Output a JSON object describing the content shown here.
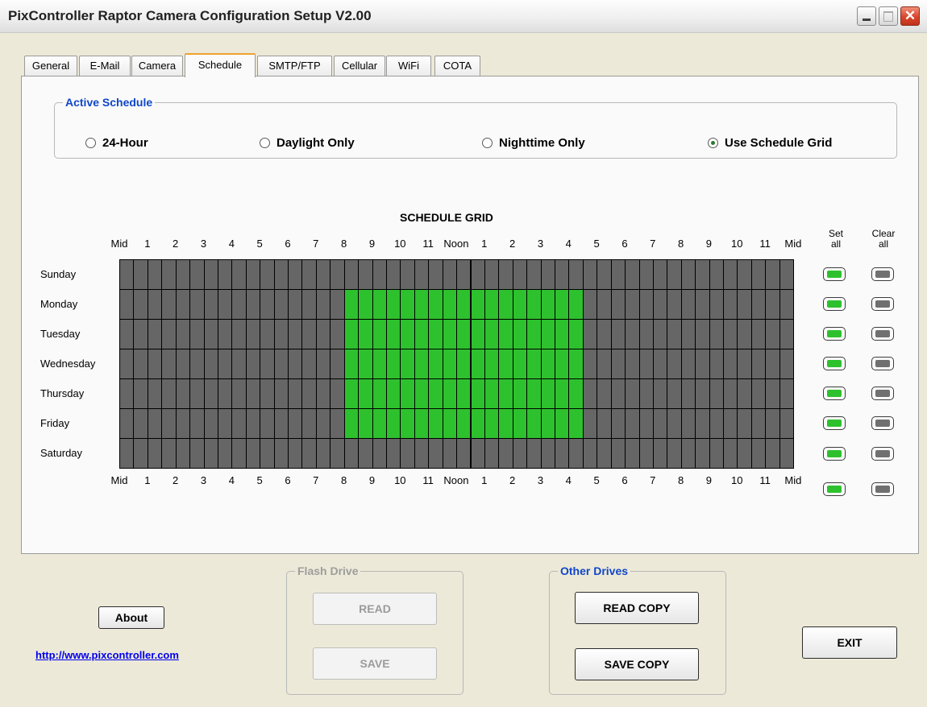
{
  "window": {
    "title": "PixController Raptor Camera Configuration Setup V2.00"
  },
  "tabs": [
    "General",
    "E-Mail",
    "Camera",
    "Schedule",
    "SMTP/FTP",
    "Cellular",
    "WiFi",
    "COTA"
  ],
  "active_tab": "Schedule",
  "active_schedule": {
    "legend": "Active Schedule",
    "options": [
      "24-Hour",
      "Daylight Only",
      "Nighttime Only",
      "Use Schedule Grid"
    ],
    "selected": "Use Schedule Grid"
  },
  "schedule_grid": {
    "title": "SCHEDULE GRID",
    "hours": [
      "Mid",
      "1",
      "2",
      "3",
      "4",
      "5",
      "6",
      "7",
      "8",
      "9",
      "10",
      "11",
      "Noon",
      "1",
      "2",
      "3",
      "4",
      "5",
      "6",
      "7",
      "8",
      "9",
      "10",
      "11",
      "Mid"
    ],
    "days": [
      "Sunday",
      "Monday",
      "Tuesday",
      "Wednesday",
      "Thursday",
      "Friday",
      "Saturday"
    ],
    "set_all_label": "Set all",
    "clear_all_label": "Clear all",
    "active_rows": [
      1,
      2,
      3,
      4,
      5
    ],
    "active_start_hour": 8,
    "active_end_hour": 16.5,
    "colors": {
      "active": "#2ec12e",
      "inactive": "#666666"
    }
  },
  "flash_drive": {
    "legend": "Flash Drive",
    "read_label": "READ",
    "save_label": "SAVE"
  },
  "other_drives": {
    "legend": "Other Drives",
    "read_copy_label": "READ COPY",
    "save_copy_label": "SAVE COPY"
  },
  "about_label": "About",
  "website_link": "http://www.pixcontroller.com",
  "exit_label": "EXIT"
}
